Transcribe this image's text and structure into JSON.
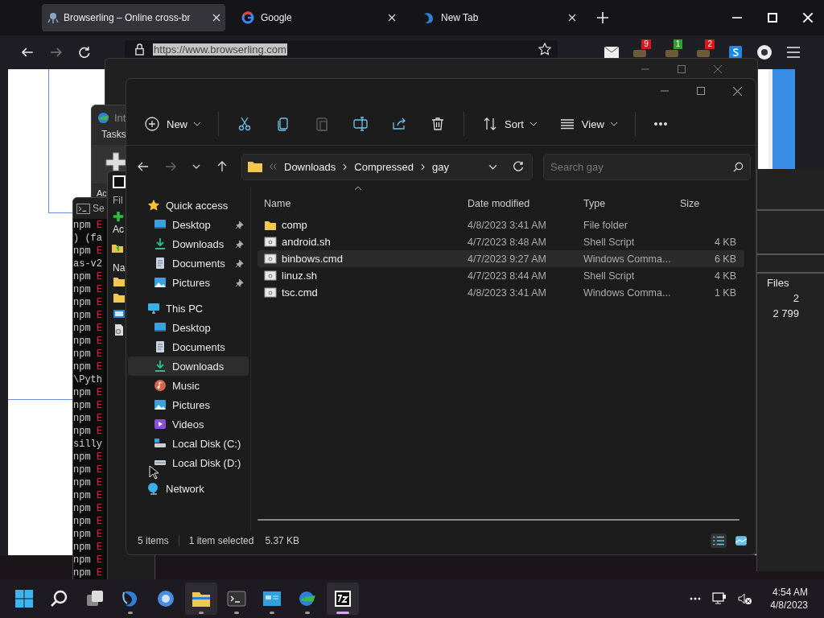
{
  "browser": {
    "tabs": [
      {
        "title": "Browserling – Online cross-br",
        "selected": true
      },
      {
        "title": "Google",
        "selected": false
      },
      {
        "title": "New Tab",
        "selected": false
      }
    ],
    "address": {
      "value": "https://www.browserling.com",
      "selected": true
    },
    "extension_badges": [
      {
        "text": "9",
        "color": "#d11a1a"
      },
      {
        "text": "1",
        "color": "#2f9e2f"
      },
      {
        "text": "2",
        "color": "#d11a1a"
      }
    ]
  },
  "idm_window": {
    "title": "Int",
    "menu": "Tasks",
    "button": "Ac"
  },
  "terminal_window": {
    "title": "Se",
    "lines": [
      {
        "text": "npm",
        "error": "E"
      },
      {
        "text": ") (fa"
      },
      {
        "text": "npm",
        "error": "E"
      },
      {
        "text": "as-v2"
      },
      {
        "text": "npm",
        "error": "E"
      },
      {
        "text": "npm",
        "error": "E"
      },
      {
        "text": "npm",
        "error": "E"
      },
      {
        "text": "npm",
        "error": "E"
      },
      {
        "text": "npm",
        "error": "E"
      },
      {
        "text": "npm",
        "error": "E"
      },
      {
        "text": "npm",
        "error": "E"
      },
      {
        "text": "npm",
        "error": "E"
      },
      {
        "text": "\\Pyth"
      },
      {
        "text": "npm",
        "error": "E"
      },
      {
        "text": "npm",
        "error": "E"
      },
      {
        "text": "npm",
        "error": "E"
      },
      {
        "text": "npm",
        "error": "E"
      },
      {
        "text": "silly"
      },
      {
        "text": "npm",
        "error": "E"
      },
      {
        "text": "npm",
        "error": "E"
      },
      {
        "text": "npm",
        "error": "E"
      },
      {
        "text": "npm",
        "error": "E"
      },
      {
        "text": "npm",
        "error": "E"
      },
      {
        "text": "npm",
        "error": "E"
      },
      {
        "text": "npm",
        "error": "E"
      },
      {
        "text": "npm",
        "error": "E"
      },
      {
        "text": "npm",
        "error": "E"
      },
      {
        "text": "npm",
        "error": "E"
      }
    ]
  },
  "archive_window": {
    "menu": "Fil",
    "button": "Ac",
    "column": "Na",
    "rows": [
      {
        "kind": "folder"
      },
      {
        "kind": "folder"
      },
      {
        "kind": "video"
      },
      {
        "kind": "settings"
      }
    ]
  },
  "stats_window": {
    "header": "Files",
    "values": [
      "2",
      "2 799"
    ]
  },
  "explorer": {
    "toolbar": [
      [
        {
          "kind": "new",
          "label": "New",
          "disabled": false
        }
      ],
      [
        {
          "kind": "cut",
          "disabled": false
        },
        {
          "kind": "copy",
          "disabled": false
        },
        {
          "kind": "paste",
          "disabled": true
        },
        {
          "kind": "rename",
          "disabled": false
        },
        {
          "kind": "share",
          "disabled": false
        },
        {
          "kind": "delete",
          "disabled": false
        }
      ],
      [
        {
          "kind": "sort",
          "label": "Sort",
          "disabled": false
        },
        {
          "kind": "view",
          "label": "View",
          "disabled": false
        }
      ],
      [
        {
          "kind": "more",
          "disabled": false
        }
      ]
    ],
    "breadcrumb": [
      "Downloads",
      "Compressed",
      "gay"
    ],
    "search": {
      "placeholder": "Search gay"
    },
    "nav": [
      {
        "label": "Quick access",
        "kind": "star",
        "selected": false,
        "children": [
          {
            "label": "Desktop",
            "kind": "desktop",
            "pinned": true,
            "selected": false
          },
          {
            "label": "Downloads",
            "kind": "downloads",
            "pinned": true,
            "selected": false
          },
          {
            "label": "Documents",
            "kind": "documents",
            "pinned": true,
            "selected": false
          },
          {
            "label": "Pictures",
            "kind": "pictures",
            "pinned": true,
            "selected": false
          }
        ]
      },
      {
        "label": "This PC",
        "kind": "pc",
        "selected": false,
        "children": [
          {
            "label": "Desktop",
            "kind": "desktop",
            "pinned": false,
            "selected": false
          },
          {
            "label": "Documents",
            "kind": "documents",
            "pinned": false,
            "selected": false
          },
          {
            "label": "Downloads",
            "kind": "downloads",
            "pinned": false,
            "selected": true
          },
          {
            "label": "Music",
            "kind": "music",
            "pinned": false,
            "selected": false
          },
          {
            "label": "Pictures",
            "kind": "pictures",
            "pinned": false,
            "selected": false
          },
          {
            "label": "Videos",
            "kind": "videos",
            "pinned": false,
            "selected": false
          },
          {
            "label": "Local Disk (C:)",
            "kind": "system-disk",
            "pinned": false,
            "selected": false
          },
          {
            "label": "Local Disk (D:)",
            "kind": "disk",
            "pinned": false,
            "selected": false
          }
        ]
      },
      {
        "label": "Network",
        "kind": "network",
        "selected": false
      }
    ],
    "columns": [
      "Name",
      "Date modified",
      "Type",
      "Size"
    ],
    "rows": [
      {
        "name": "comp",
        "kind": "folder",
        "date": "4/8/2023 3:41 AM",
        "type": "File folder",
        "selected": false
      },
      {
        "name": "android.sh",
        "kind": "script",
        "date": "4/7/2023 8:48 AM",
        "type": "Shell Script",
        "size": "4 KB",
        "selected": false
      },
      {
        "name": "binbows.cmd",
        "kind": "script",
        "date": "4/7/2023 9:27 AM",
        "type": "Windows Comma...",
        "size": "6 KB",
        "selected": true
      },
      {
        "name": "linuz.sh",
        "kind": "script",
        "date": "4/7/2023 8:44 AM",
        "type": "Shell Script",
        "size": "4 KB",
        "selected": false
      },
      {
        "name": "tsc.cmd",
        "kind": "script",
        "date": "4/8/2023 3:41 AM",
        "type": "Windows Comma...",
        "size": "1 KB",
        "selected": false
      }
    ],
    "status": {
      "count": "5 items",
      "selection": "1 item selected",
      "size": "5.37 KB"
    },
    "views": [
      {
        "kind": "details",
        "selected": true
      },
      {
        "kind": "tiles",
        "selected": false
      }
    ]
  },
  "taskbar": {
    "apps": [
      {
        "kind": "start",
        "running": false,
        "focused": false
      },
      {
        "kind": "search",
        "running": false,
        "focused": false
      },
      {
        "kind": "task-view",
        "running": false,
        "focused": false
      },
      {
        "kind": "browser",
        "running": true,
        "focused": false
      },
      {
        "kind": "circle-app",
        "running": false,
        "focused": false
      },
      {
        "kind": "explorer",
        "running": true,
        "focused": true
      },
      {
        "kind": "terminal",
        "running": true,
        "focused": false
      },
      {
        "kind": "window-app",
        "running": true,
        "focused": false
      },
      {
        "kind": "download-app",
        "running": true,
        "focused": false
      },
      {
        "kind": "archive",
        "running": true,
        "focused": true
      }
    ],
    "time": "4:54 AM",
    "date": "4/8/2023"
  }
}
